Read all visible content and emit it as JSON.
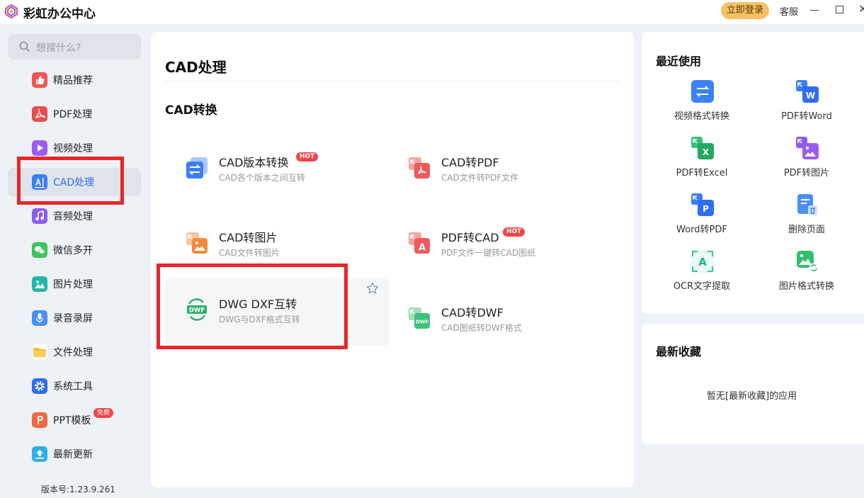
{
  "app": {
    "title": "彩虹办公中心",
    "login": "立即登录",
    "service": "客服",
    "close_glyph": "✕"
  },
  "search": {
    "placeholder": "想搜什么?"
  },
  "sidebar": {
    "items": [
      {
        "label": "精品推荐",
        "icon": "thumbs-up-icon",
        "color": "#ef5555"
      },
      {
        "label": "PDF处理",
        "icon": "pdf-icon",
        "color": "#ea4b4b"
      },
      {
        "label": "视频处理",
        "icon": "play-icon",
        "color": "#9b5cf2"
      },
      {
        "label": "CAD处理",
        "icon": "cad-icon",
        "color": "#3b7ef6"
      },
      {
        "label": "音频处理",
        "icon": "music-icon",
        "color": "#8a5cf2"
      },
      {
        "label": "微信多开",
        "icon": "wechat-icon",
        "color": "#3cc55c"
      },
      {
        "label": "图片处理",
        "icon": "image-icon",
        "color": "#22b7a8"
      },
      {
        "label": "录音录屏",
        "icon": "microphone-icon",
        "color": "#4a8ff7"
      },
      {
        "label": "文件处理",
        "icon": "folder-icon",
        "color": "#f6b93b"
      },
      {
        "label": "系统工具",
        "icon": "gear-icon",
        "color": "#2f6df3"
      },
      {
        "label": "PPT模板",
        "icon": "ppt-icon",
        "color": "#f0683d",
        "badge": "免费"
      },
      {
        "label": "最新更新",
        "icon": "upload-icon",
        "color": "#2eaee8"
      }
    ],
    "active": "CAD处理",
    "version": "版本号:1.23.9.261"
  },
  "main": {
    "title": "CAD处理",
    "section": "CAD转换",
    "tools": [
      {
        "name": "CAD版本转换",
        "desc": "CAD各个版本之间互转",
        "hot": "HOT",
        "icon": "cad-version-icon"
      },
      {
        "name": "CAD转PDF",
        "desc": "CAD文件转PDF文件",
        "icon": "cad-to-pdf-icon"
      },
      {
        "name": "CAD转图片",
        "desc": "CAD文件转图片",
        "icon": "cad-to-image-icon"
      },
      {
        "name": "PDF转CAD",
        "desc": "PDF文件一键转CAD图纸",
        "hot": "HOT",
        "icon": "pdf-to-cad-icon"
      },
      {
        "name": "DWG DXF互转",
        "desc": "DWG与DXF格式互转",
        "icon": "dwg-dxf-icon"
      },
      {
        "name": "CAD转DWF",
        "desc": "CAD图纸转DWF格式",
        "icon": "cad-to-dwf-icon"
      }
    ],
    "icon_text": {
      "dwf": "DWF",
      "pdf_a": "A"
    }
  },
  "recent": {
    "title": "最近使用",
    "items": [
      {
        "label": "视频格式转换",
        "icon": "video-convert-icon"
      },
      {
        "label": "PDF转Word",
        "icon": "pdf-to-word-icon",
        "letter": "W"
      },
      {
        "label": "PDF转Excel",
        "icon": "pdf-to-excel-icon",
        "letter": "X"
      },
      {
        "label": "PDF转图片",
        "icon": "pdf-to-image-icon"
      },
      {
        "label": "Word转PDF",
        "icon": "word-to-pdf-icon",
        "letter": "P"
      },
      {
        "label": "删除页面",
        "icon": "delete-page-icon"
      },
      {
        "label": "OCR文字提取",
        "icon": "ocr-icon",
        "letter": "A"
      },
      {
        "label": "图片格式转换",
        "icon": "image-convert-icon"
      }
    ]
  },
  "favorites": {
    "title": "最新收藏",
    "empty": "暂无[最新收藏]的应用"
  },
  "colors": {
    "accent": "#2f6df3",
    "hot": "#f2454a",
    "highlight": "#e8262a",
    "login": "#f4c266"
  }
}
